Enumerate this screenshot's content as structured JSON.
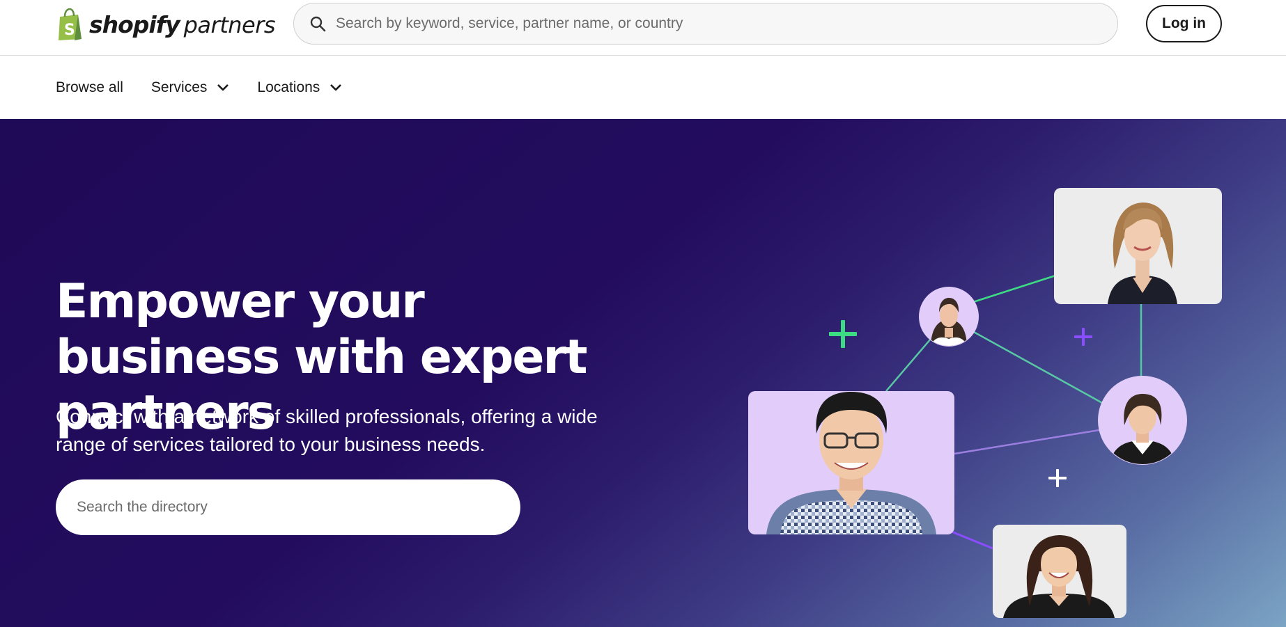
{
  "header": {
    "logo_word_1": "shopify",
    "logo_word_2": "partners",
    "search_placeholder": "Search by keyword, service, partner name, or country",
    "login_label": "Log in"
  },
  "subnav": {
    "items": [
      {
        "label": "Browse all"
      },
      {
        "label": "Services"
      },
      {
        "label": "Locations"
      }
    ]
  },
  "hero": {
    "title": "Empower your business with expert partners",
    "subtitle": "Connect with a network of skilled professionals, offering a wide range of services tailored to your business needs.",
    "search_placeholder": "Search the directory"
  },
  "colors": {
    "brand_green": "#95bf47",
    "hero_bg_dark": "#1f0a57",
    "accent_green": "#3ddc84",
    "accent_purple": "#8a4dff",
    "photo_bg_lavender": "#e2cdfa"
  }
}
